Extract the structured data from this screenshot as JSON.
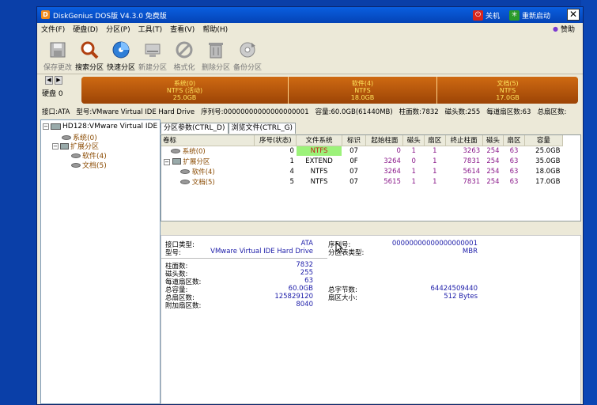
{
  "window": {
    "title": "DiskGenius DOS版 V4.3.0 免费版",
    "shutdown": "关机",
    "restart": "重新启动"
  },
  "menu": [
    "文件(F)",
    "硬盘(D)",
    "分区(P)",
    "工具(T)",
    "查看(V)",
    "帮助(H)"
  ],
  "donate": "赞助",
  "toolbar": [
    {
      "label": "保存更改",
      "icon": "save-icon"
    },
    {
      "label": "搜索分区",
      "icon": "search-icon"
    },
    {
      "label": "快速分区",
      "icon": "quick-partition-icon"
    },
    {
      "label": "新建分区",
      "icon": "new-partition-icon"
    },
    {
      "label": "格式化",
      "icon": "format-icon"
    },
    {
      "label": "删除分区",
      "icon": "delete-icon"
    },
    {
      "label": "备份分区",
      "icon": "backup-icon"
    }
  ],
  "disk": {
    "label": "硬盘 0",
    "segments": [
      {
        "name": "系统(0)",
        "fs": "NTFS (活动)",
        "size": "25.0GB"
      },
      {
        "name": "软件(4)",
        "fs": "NTFS",
        "size": "18.0GB"
      },
      {
        "name": "文档(5)",
        "fs": "NTFS",
        "size": "17.0GB"
      }
    ],
    "segment_fractions": [
      0.417,
      0.3,
      0.283
    ]
  },
  "info": {
    "interface": "接口:ATA",
    "model": "型号:VMware Virtual IDE Hard Drive",
    "serial": "序列号:00000000000000000001",
    "capacity": "容量:60.0GB(61440MB)",
    "cylinders": "柱面数:7832",
    "heads": "磁头数:255",
    "sectors": "每道扇区数:63",
    "total_sectors": "总扇区数:"
  },
  "tree": {
    "disk": "HD128:VMware Virtual IDE H",
    "items": [
      "系统(0)",
      "扩展分区",
      "软件(4)",
      "文档(5)"
    ]
  },
  "tabs": [
    "分区参数(CTRL_D)",
    "浏览文件(CTRL_G)"
  ],
  "table": {
    "headers": [
      "卷标",
      "序号(状态)",
      "文件系统",
      "标识",
      "起始柱面",
      "磁头",
      "扇区",
      "终止柱面",
      "磁头",
      "扇区",
      "容量"
    ],
    "rows": [
      [
        "系统(0)",
        "0",
        "NTFS",
        "07",
        "0",
        "1",
        "1",
        "3263",
        "254",
        "63",
        "25.0GB"
      ],
      [
        "扩展分区",
        "1",
        "EXTEND",
        "0F",
        "3264",
        "0",
        "1",
        "7831",
        "254",
        "63",
        "35.0GB"
      ],
      [
        "软件(4)",
        "4",
        "NTFS",
        "07",
        "3264",
        "1",
        "1",
        "5614",
        "254",
        "63",
        "18.0GB"
      ],
      [
        "文档(5)",
        "5",
        "NTFS",
        "07",
        "5615",
        "1",
        "1",
        "7831",
        "254",
        "63",
        "17.0GB"
      ]
    ]
  },
  "details": {
    "interface_label": "接口类型:",
    "interface_value": "ATA",
    "serial_label": "序列号:",
    "serial_value": "00000000000000000001",
    "model_label": "型号:",
    "model_value": "VMware Virtual IDE Hard Drive",
    "ptype_label": "分区表类型:",
    "ptype_value": "MBR",
    "cyl_label": "柱面数:",
    "cyl_value": "7832",
    "heads_label": "磁头数:",
    "heads_value": "255",
    "spt_label": "每道扇区数:",
    "spt_value": "63",
    "cap_label": "总容量:",
    "cap_value": "60.0GB",
    "bytes_label": "总字节数:",
    "bytes_value": "64424509440",
    "ts_label": "总扇区数:",
    "ts_value": "125829120",
    "ss_label": "扇区大小:",
    "ss_value": "512 Bytes",
    "extra_label": "附加扇区数:",
    "extra_value": "8040"
  },
  "colors": {
    "titlebar": "#0a5fe0",
    "partition": "#b5560a",
    "partition_text": "#ffe45c",
    "ntfs_highlight": "#9cf27a"
  }
}
